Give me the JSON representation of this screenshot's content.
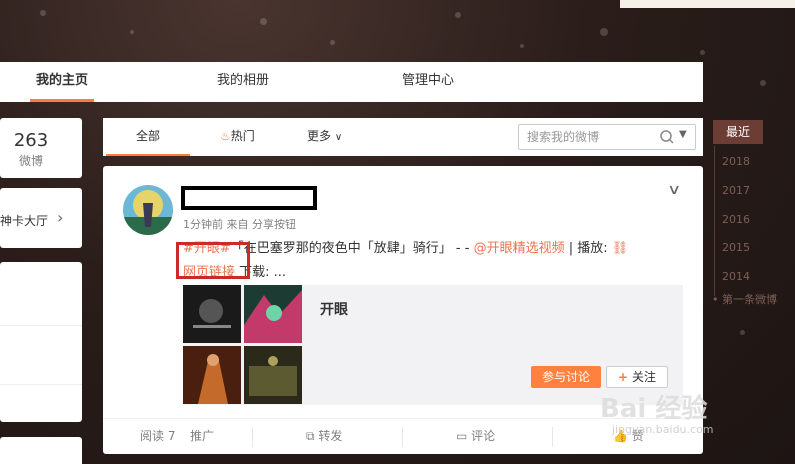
{
  "nav": {
    "home": "我的主页",
    "albums": "我的相册",
    "admin": "管理中心"
  },
  "profile": {
    "weibo_count": "263",
    "weibo_label": "微博",
    "hall_label": "神卡大厅"
  },
  "tabs": {
    "all": "全部",
    "hot": "热门",
    "more": "更多",
    "search_placeholder": "搜索我的微博"
  },
  "timeline": {
    "latest": "最近",
    "years": [
      "2018",
      "2017",
      "2016",
      "2015",
      "2014"
    ],
    "first": "第一条微博"
  },
  "post": {
    "meta": "1分钟前 来自 分享按钮",
    "topic": "#开眼#",
    "text": "「在巴塞罗那的夜色中「放肆」骑行」 - - ",
    "mention": "@开眼精选视频",
    "play_label": " | 播放: ",
    "link_text": "网页链接",
    "download_label": " 下载: ...",
    "card_title": "开眼",
    "discuss_button": "参与讨论",
    "follow_button": "关注"
  },
  "actions": {
    "read": "阅读 7",
    "promote": "推广",
    "repost": "转发",
    "comment": "评论",
    "like": "赞"
  },
  "watermark": {
    "brand": "Bai 经验",
    "url": "jingyan.baidu.com"
  },
  "colors": {
    "accent": "#fa7d3c",
    "link": "#eb7350",
    "highlight_box": "#cc2a2a",
    "timeline_bg": "#6b3d35"
  },
  "icons": [
    "fire-icon",
    "chevron-down-icon",
    "search-icon",
    "link-icon",
    "plus-icon",
    "repost-icon",
    "comment-icon",
    "like-icon"
  ]
}
